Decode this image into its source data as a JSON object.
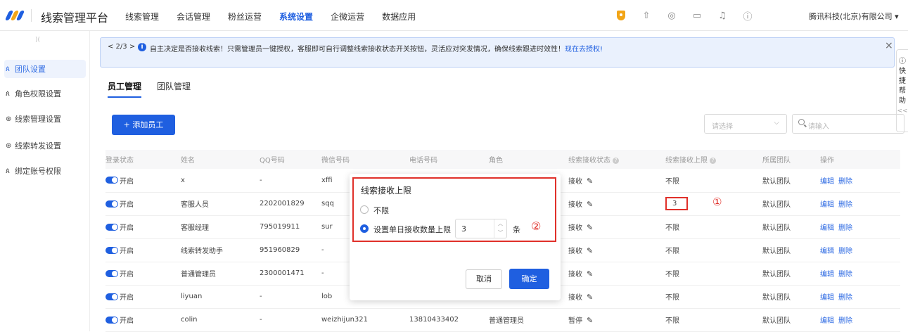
{
  "header": {
    "brand": "线索管理平台",
    "nav": [
      "线索管理",
      "会话管理",
      "粉丝运营",
      "系统设置",
      "企微运营",
      "数据应用"
    ],
    "active_nav": "系统设置",
    "company": "腾讯科技(北京)有限公司 ▾",
    "colors": {
      "accent": "#1f5fe0",
      "shield": "#f2a516"
    }
  },
  "sidebar": {
    "collapse": ")(",
    "items": [
      {
        "label": "团队设置",
        "icon": "team-icon"
      },
      {
        "label": "角色权限设置",
        "icon": "role-icon"
      },
      {
        "label": "线索管理设置",
        "icon": "lead-settings-icon"
      },
      {
        "label": "线索转发设置",
        "icon": "forward-settings-icon"
      },
      {
        "label": "绑定账号权限",
        "icon": "bind-account-icon"
      }
    ],
    "active": "团队设置"
  },
  "banner": {
    "pager": "< 2/3 >",
    "message": "自主决定是否接收线索！只需管理员一键授权，客服即可自行调整线索接收状态开关按钮，灵活应对突发情况，确保线索跟进时效性！",
    "link": "现在去授权!"
  },
  "help": {
    "label": "快捷帮助",
    "collapse": "<<"
  },
  "tabs": [
    "员工管理",
    "团队管理"
  ],
  "toolbar": {
    "add_label": "+ 添加员工",
    "select_placeholder": "请选择",
    "search_placeholder": "请输入"
  },
  "table": {
    "headers": [
      "登录状态",
      "姓名",
      "QQ号码",
      "微信号码",
      "电话号码",
      "角色",
      "线索接收状态",
      "线索接收上限",
      "所属团队",
      "操作"
    ],
    "toggle_label": "开启",
    "edit_label": "编辑",
    "delete_label": "删除",
    "rows": [
      {
        "name": "x",
        "qq": "-",
        "wechat": "xffi",
        "phone": "",
        "role": "",
        "status": "接收",
        "limit": "不限",
        "team": "默认团队"
      },
      {
        "name": "客服人员",
        "qq": "2202001829",
        "wechat": "sqq",
        "phone": "",
        "role": "",
        "status": "接收",
        "limit": "3",
        "team": "默认团队"
      },
      {
        "name": "客服经理",
        "qq": "795019911",
        "wechat": "sur",
        "phone": "",
        "role": "",
        "status": "接收",
        "limit": "不限",
        "team": "默认团队"
      },
      {
        "name": "线索转发助手",
        "qq": "951960829",
        "wechat": "-",
        "phone": "",
        "role": "",
        "status": "接收",
        "limit": "不限",
        "team": "默认团队"
      },
      {
        "name": "普通管理员",
        "qq": "2300001471",
        "wechat": "-",
        "phone": "",
        "role": "",
        "status": "接收",
        "limit": "不限",
        "team": "默认团队"
      },
      {
        "name": "liyuan",
        "qq": "-",
        "wechat": "lob",
        "phone": "",
        "role": "",
        "status": "接收",
        "limit": "不限",
        "team": "默认团队"
      },
      {
        "name": "colin",
        "qq": "-",
        "wechat": "weizhijun321",
        "phone": "13810433402",
        "role": "普通管理员",
        "status": "暂停",
        "limit": "不限",
        "team": "默认团队"
      }
    ]
  },
  "annotations": {
    "first": "①",
    "second": "②"
  },
  "popup": {
    "title": "线索接收上限",
    "option_unlimited": "不限",
    "option_limit": "设置单日接收数量上限",
    "limit_value": "3",
    "unit": "条",
    "cancel": "取消",
    "confirm": "确定"
  }
}
